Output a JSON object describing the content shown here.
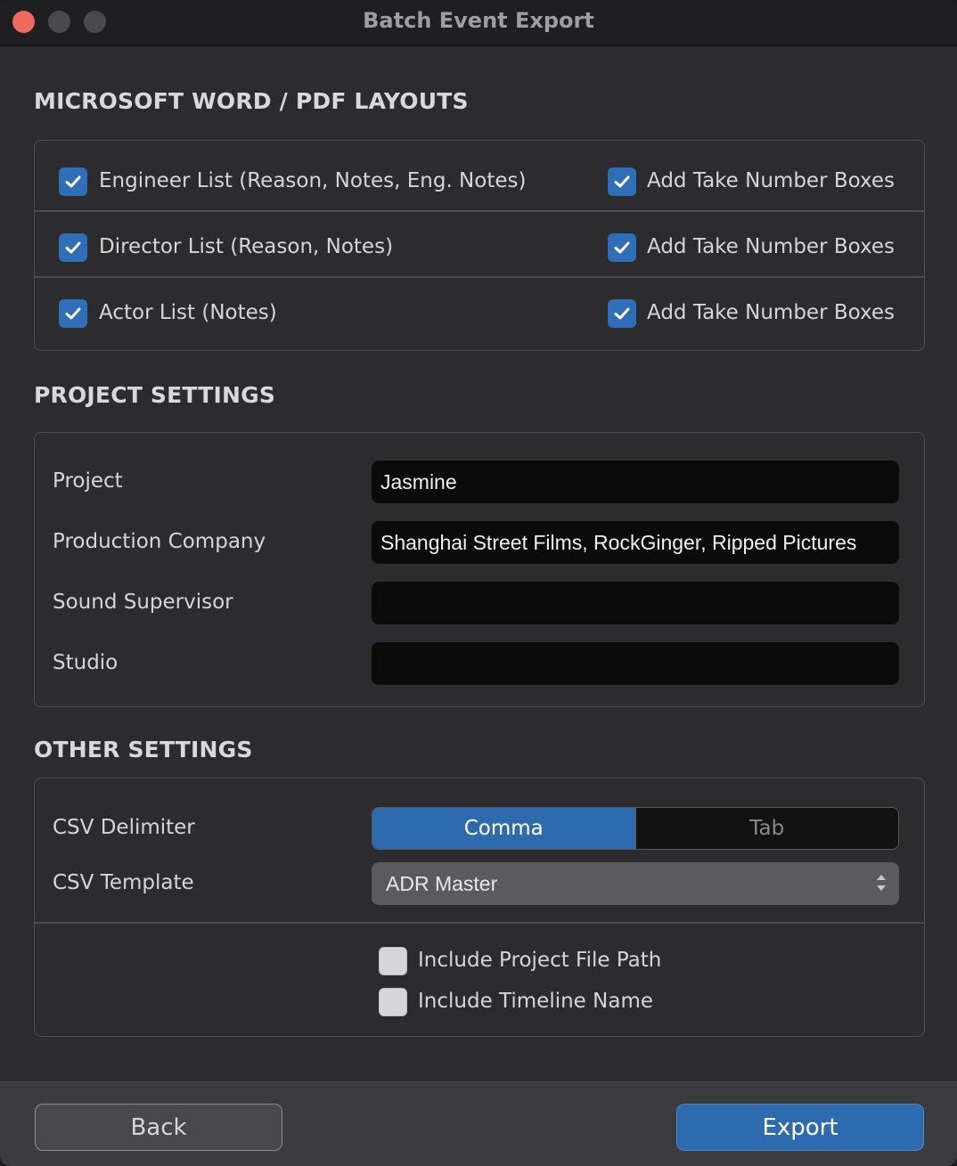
{
  "window": {
    "title": "Batch Event Export"
  },
  "sections": {
    "layouts": "MICROSOFT WORD / PDF LAYOUTS",
    "project": "PROJECT SETTINGS",
    "other": "OTHER SETTINGS"
  },
  "layouts": [
    {
      "label": "Engineer List (Reason, Notes, Eng. Notes)",
      "checked": true,
      "take_label": "Add Take Number Boxes",
      "take_checked": true
    },
    {
      "label": "Director List (Reason, Notes)",
      "checked": true,
      "take_label": "Add Take Number Boxes",
      "take_checked": true
    },
    {
      "label": "Actor List (Notes)",
      "checked": true,
      "take_label": "Add Take Number Boxes",
      "take_checked": true
    }
  ],
  "project_fields": [
    {
      "label": "Project",
      "value": "Jasmine"
    },
    {
      "label": "Production Company",
      "value": "Shanghai Street Films, RockGinger, Ripped Pictures"
    },
    {
      "label": "Sound Supervisor",
      "value": ""
    },
    {
      "label": "Studio",
      "value": ""
    }
  ],
  "other": {
    "csv_delimiter_label": "CSV Delimiter",
    "delimiter_options": [
      "Comma",
      "Tab"
    ],
    "delimiter_selected": "Comma",
    "csv_template_label": "CSV Template",
    "csv_template_value": "ADR Master",
    "include_project_file_path": {
      "label": "Include Project File Path",
      "checked": false
    },
    "include_timeline_name": {
      "label": "Include Timeline Name",
      "checked": false
    }
  },
  "buttons": {
    "back": "Back",
    "export": "Export"
  },
  "colors": {
    "accent": "#2e6aae",
    "close": "#ee6a5e",
    "background": "#2c2c2e",
    "input": "#0b0b0c"
  }
}
